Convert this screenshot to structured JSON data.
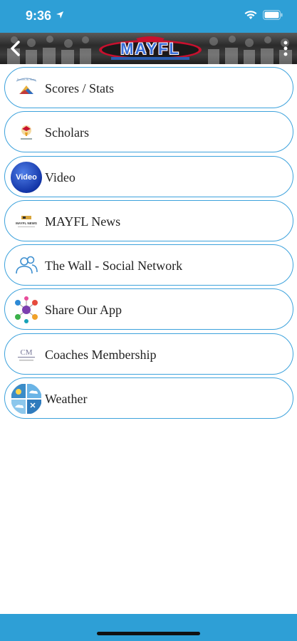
{
  "status_bar": {
    "time": "9:36"
  },
  "header": {
    "logo_text": "MAYFL"
  },
  "menu": {
    "items": [
      {
        "label": "Scores / Stats",
        "icon": "scores-stats-icon",
        "icon_text": "Scores & Stats"
      },
      {
        "label": "Scholars",
        "icon": "scholars-icon"
      },
      {
        "label": "Video",
        "icon": "video-icon",
        "icon_text": "Video"
      },
      {
        "label": "MAYFL News",
        "icon": "news-icon",
        "icon_text": "MAYFL NEWS"
      },
      {
        "label": "The Wall - Social Network",
        "icon": "people-icon"
      },
      {
        "label": "Share Our App",
        "icon": "share-icon"
      },
      {
        "label": "Coaches Membership",
        "icon": "coaches-membership-icon",
        "icon_text": "CM"
      },
      {
        "label": "Weather",
        "icon": "weather-icon"
      }
    ]
  },
  "colors": {
    "accent": "#2e9fd6",
    "item_border": "#3da2dc"
  }
}
